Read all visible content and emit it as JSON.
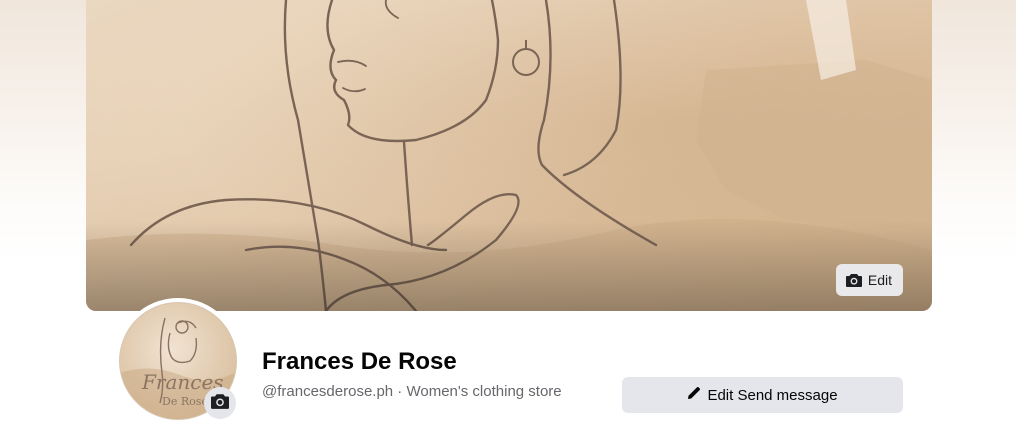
{
  "cover": {
    "edit_label": "Edit"
  },
  "profile": {
    "name": "Frances De Rose",
    "handle": "@francesderose.ph",
    "separator": " · ",
    "category": "Women's clothing store",
    "logo_text_1": "Frances",
    "logo_text_2": "De Rose"
  },
  "actions": {
    "edit_send_message_label": "Edit Send message"
  },
  "icons": {
    "cover_edit": "camera-icon",
    "avatar_edit": "camera-icon",
    "action": "pencil-icon"
  },
  "colors": {
    "button_bg": "#e4e6eb",
    "text_primary": "#050505",
    "text_secondary": "#65676b",
    "cover_tone": "#e2c8aa"
  }
}
